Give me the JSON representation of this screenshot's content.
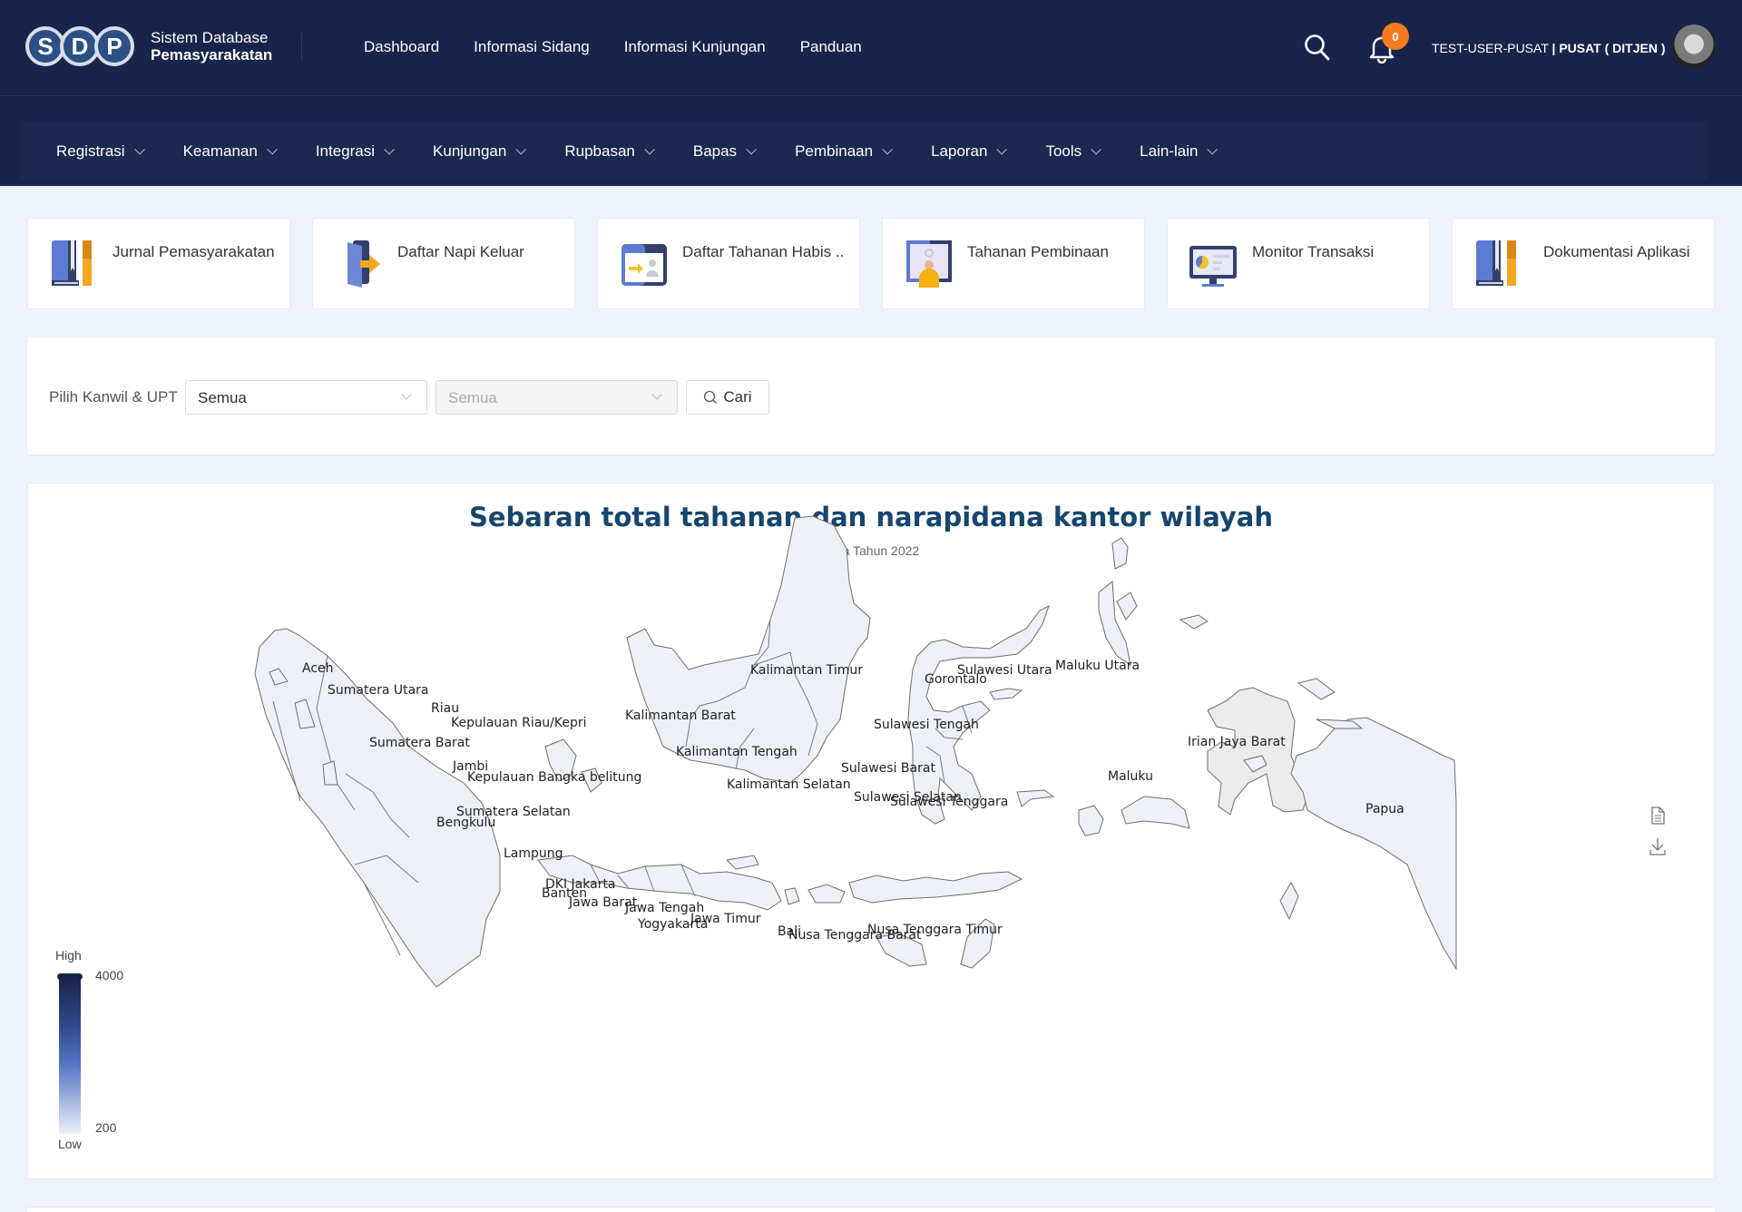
{
  "header": {
    "logo_letters": [
      "S",
      "D",
      "P"
    ],
    "app_name_line1": "Sistem Database",
    "app_name_line2": "Pemasyarakatan",
    "nav": [
      "Dashboard",
      "Informasi Sidang",
      "Informasi Kunjungan",
      "Panduan"
    ],
    "notification_count": "0",
    "user_name": "TEST-USER-PUSAT",
    "user_separator": "|",
    "user_unit": "PUSAT ( DITJEN )",
    "icons": {
      "search": "search-icon",
      "notifications": "bell-icon",
      "avatar": "user-avatar"
    }
  },
  "menu": [
    "Registrasi",
    "Keamanan",
    "Integrasi",
    "Kunjungan",
    "Rupbasan",
    "Bapas",
    "Pembinaan",
    "Laporan",
    "Tools",
    "Lain-lain"
  ],
  "quick_links": [
    {
      "label": "Jurnal Pemasyarakatan",
      "icon": "book-icon"
    },
    {
      "label": "Daftar Napi Keluar",
      "icon": "door-exit-icon"
    },
    {
      "label": "Daftar Tahanan Habis ..",
      "icon": "calendar-person-icon"
    },
    {
      "label": "Tahanan Pembinaan",
      "icon": "person-board-icon"
    },
    {
      "label": "Monitor Transaksi",
      "icon": "monitor-chart-icon"
    },
    {
      "label": "Dokumentasi Aplikasi",
      "icon": "book-icon"
    }
  ],
  "filter": {
    "label": "Pilih Kanwil & UPT",
    "kanwil_value": "Semua",
    "upt_value": "Semua",
    "search_button": "Cari"
  },
  "chart_data": {
    "type": "choropleth-map",
    "title": "Sebaran total tahanan dan narapidana kantor wilayah",
    "subtitle": "Data Tahun 2022",
    "region": "Indonesia",
    "regions": [
      "Aceh",
      "Sumatera Utara",
      "Riau",
      "Kepulauan Riau/Kepri",
      "Sumatera Barat",
      "Jambi",
      "Kepulauan Bangka belitung",
      "Sumatera Selatan",
      "Bengkulu",
      "Lampung",
      "DKI Jakarta",
      "Banten",
      "Jawa Barat",
      "Jawa Tengah",
      "Yogyakarta",
      "Jawa Timur",
      "Bali",
      "Nusa Tenggara Barat",
      "Nusa Tenggara Timur",
      "Kalimantan Barat",
      "Kalimantan Tengah",
      "Kalimantan Selatan",
      "Kalimantan Timur",
      "Sulawesi Utara",
      "Gorontalo",
      "Sulawesi Tengah",
      "Sulawesi Barat",
      "Sulawesi Selatan",
      "Sulawesi Tenggara",
      "Maluku Utara",
      "Maluku",
      "Irian Jaya Barat",
      "Papua"
    ],
    "visual_map": {
      "min": 200,
      "max": 4000,
      "high_label": "High",
      "low_label": "Low",
      "min_label": "200",
      "max_label": "4000",
      "color_high": "#1a2447",
      "color_low": "#eef1fa"
    },
    "legend_position": "bottom-left",
    "toolbox": [
      "data-view-icon",
      "download-icon"
    ]
  }
}
